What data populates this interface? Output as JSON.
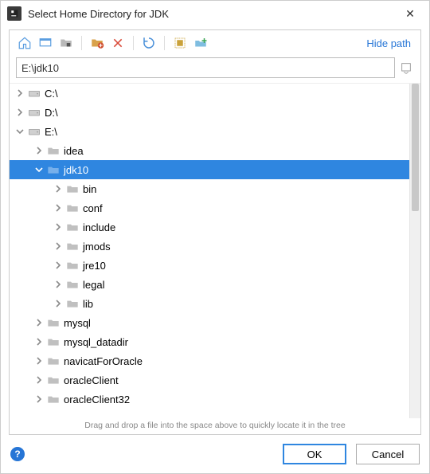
{
  "window": {
    "title": "Select Home Directory for JDK"
  },
  "toolbar": {
    "hide_path": "Hide path"
  },
  "path": {
    "value": "E:\\jdk10"
  },
  "tree": {
    "nodes": [
      {
        "depth": 0,
        "expand": "closed",
        "icon": "drive",
        "label": "C:\\",
        "selected": false
      },
      {
        "depth": 0,
        "expand": "closed",
        "icon": "drive",
        "label": "D:\\",
        "selected": false
      },
      {
        "depth": 0,
        "expand": "open",
        "icon": "drive",
        "label": "E:\\",
        "selected": false
      },
      {
        "depth": 1,
        "expand": "closed",
        "icon": "folder",
        "label": "idea",
        "selected": false
      },
      {
        "depth": 1,
        "expand": "open",
        "icon": "folder",
        "label": "jdk10",
        "selected": true
      },
      {
        "depth": 2,
        "expand": "closed",
        "icon": "folder",
        "label": "bin",
        "selected": false
      },
      {
        "depth": 2,
        "expand": "closed",
        "icon": "folder",
        "label": "conf",
        "selected": false
      },
      {
        "depth": 2,
        "expand": "closed",
        "icon": "folder",
        "label": "include",
        "selected": false
      },
      {
        "depth": 2,
        "expand": "closed",
        "icon": "folder",
        "label": "jmods",
        "selected": false
      },
      {
        "depth": 2,
        "expand": "closed",
        "icon": "folder",
        "label": "jre10",
        "selected": false
      },
      {
        "depth": 2,
        "expand": "closed",
        "icon": "folder",
        "label": "legal",
        "selected": false
      },
      {
        "depth": 2,
        "expand": "closed",
        "icon": "folder",
        "label": "lib",
        "selected": false
      },
      {
        "depth": 1,
        "expand": "closed",
        "icon": "folder",
        "label": "mysql",
        "selected": false
      },
      {
        "depth": 1,
        "expand": "closed",
        "icon": "folder",
        "label": "mysql_datadir",
        "selected": false
      },
      {
        "depth": 1,
        "expand": "closed",
        "icon": "folder",
        "label": "navicatForOracle",
        "selected": false
      },
      {
        "depth": 1,
        "expand": "closed",
        "icon": "folder",
        "label": "oracleClient",
        "selected": false
      },
      {
        "depth": 1,
        "expand": "closed",
        "icon": "folder",
        "label": "oracleClient32",
        "selected": false
      }
    ]
  },
  "hint": "Drag and drop a file into the space above to quickly locate it in the tree",
  "footer": {
    "ok": "OK",
    "cancel": "Cancel"
  }
}
